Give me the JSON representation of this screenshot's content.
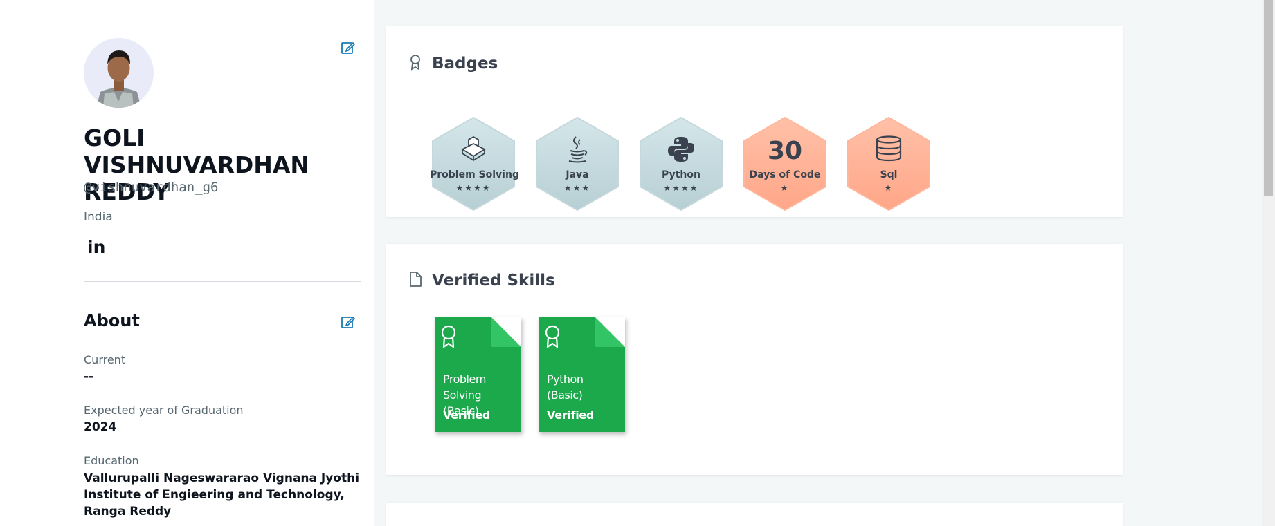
{
  "profile": {
    "name": "GOLI VISHNUVARDHAN REDDY",
    "username": "@vishnuvardhan_g6",
    "country": "India",
    "linkedin_label": "in"
  },
  "about": {
    "title": "About",
    "current_label": "Current",
    "current_value": "--",
    "graduation_label": "Expected year of Graduation",
    "graduation_value": "2024",
    "education_label": "Education",
    "education_value": "Vallurupalli Nageswararao Vignana Jyothi Institute of Engieering and Technology, Ranga Reddy"
  },
  "badges_section": {
    "title": "Badges",
    "badges": [
      {
        "name": "Problem Solving",
        "stars": "★★★★",
        "icon": "cube-icon",
        "color": "#c9dfe3"
      },
      {
        "name": "Java",
        "stars": "★★★",
        "icon": "coffee-cup-icon",
        "color": "#c9dfe3"
      },
      {
        "name": "Python",
        "stars": "★★★★",
        "icon": "python-icon",
        "color": "#c9dfe3"
      },
      {
        "name": "Days of Code",
        "number": "30",
        "stars": "★",
        "icon": "",
        "color": "#ffae93"
      },
      {
        "name": "Sql",
        "stars": "★",
        "icon": "database-icon",
        "color": "#ffae93"
      }
    ]
  },
  "skills_section": {
    "title": "Verified Skills",
    "skills": [
      {
        "name": "Problem Solving (Basic)",
        "status": "Verified"
      },
      {
        "name": "Python (Basic)",
        "status": "Verified"
      }
    ]
  },
  "colors": {
    "accent": "#1ba94c",
    "edit_icon": "#1a7ab5",
    "heading": "#39424e"
  }
}
